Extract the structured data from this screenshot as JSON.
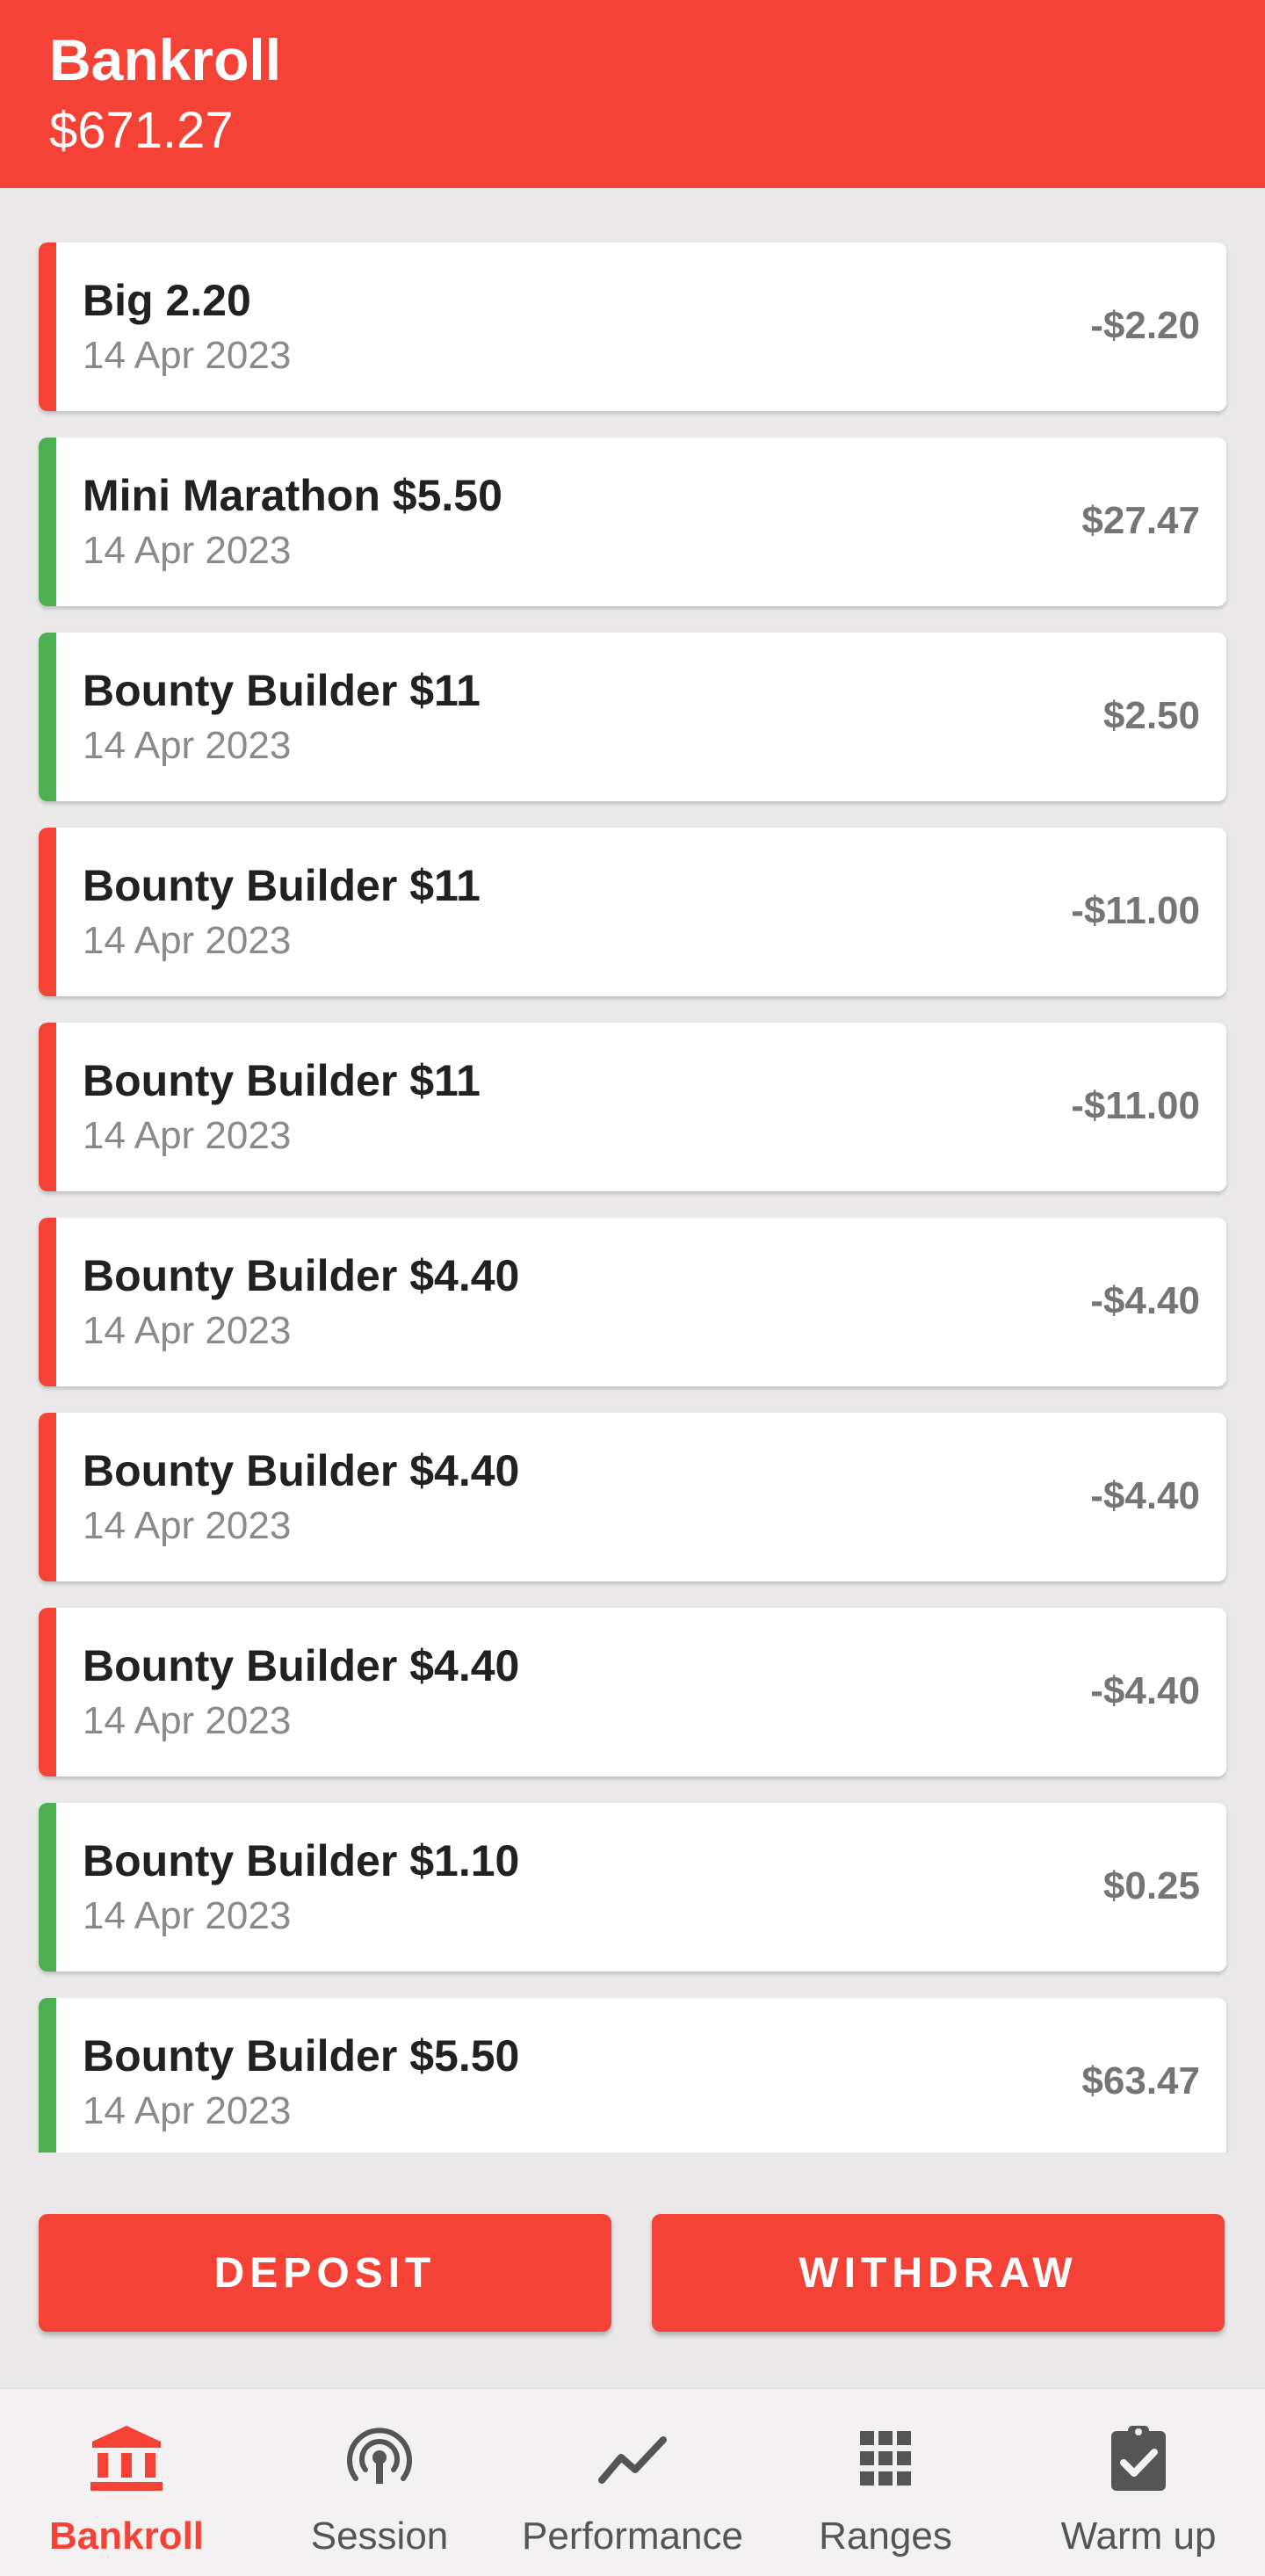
{
  "header": {
    "title": "Bankroll",
    "balance": "$671.27"
  },
  "colors": {
    "accent": "#f44336",
    "win": "#4caf50",
    "loss": "#f44336"
  },
  "transactions": [
    {
      "name": "Big 2.20",
      "date": "14 Apr 2023",
      "amount": "-$2.20",
      "result": "loss"
    },
    {
      "name": "Mini Marathon $5.50",
      "date": "14 Apr 2023",
      "amount": "$27.47",
      "result": "win"
    },
    {
      "name": "Bounty Builder $11",
      "date": "14 Apr 2023",
      "amount": "$2.50",
      "result": "win"
    },
    {
      "name": "Bounty Builder $11",
      "date": "14 Apr 2023",
      "amount": "-$11.00",
      "result": "loss"
    },
    {
      "name": "Bounty Builder $11",
      "date": "14 Apr 2023",
      "amount": "-$11.00",
      "result": "loss"
    },
    {
      "name": "Bounty Builder $4.40",
      "date": "14 Apr 2023",
      "amount": "-$4.40",
      "result": "loss"
    },
    {
      "name": "Bounty Builder $4.40",
      "date": "14 Apr 2023",
      "amount": "-$4.40",
      "result": "loss"
    },
    {
      "name": "Bounty Builder $4.40",
      "date": "14 Apr 2023",
      "amount": "-$4.40",
      "result": "loss"
    },
    {
      "name": "Bounty Builder $1.10",
      "date": "14 Apr 2023",
      "amount": "$0.25",
      "result": "win"
    },
    {
      "name": "Bounty Builder $5.50",
      "date": "14 Apr 2023",
      "amount": "$63.47",
      "result": "win"
    }
  ],
  "actions": {
    "deposit": "DEPOSIT",
    "withdraw": "WITHDRAW"
  },
  "nav": [
    {
      "label": "Bankroll",
      "icon": "bank-icon",
      "active": true
    },
    {
      "label": "Session",
      "icon": "broadcast-icon",
      "active": false
    },
    {
      "label": "Performance",
      "icon": "trending-icon",
      "active": false
    },
    {
      "label": "Ranges",
      "icon": "grid-icon",
      "active": false
    },
    {
      "label": "Warm up",
      "icon": "clipboard-check-icon",
      "active": false
    }
  ]
}
